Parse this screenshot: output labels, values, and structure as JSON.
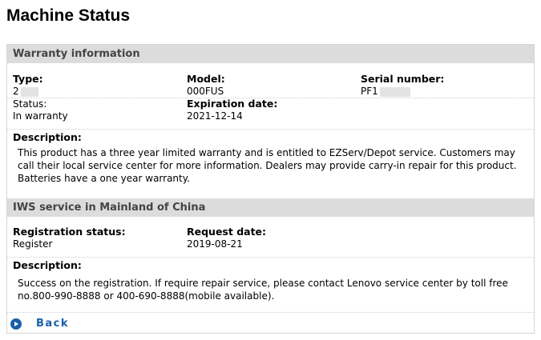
{
  "page": {
    "title": "Machine Status"
  },
  "warranty": {
    "header": "Warranty information",
    "type_label": "Type:",
    "type_value": "2",
    "model_label": "Model:",
    "model_value": "000FUS",
    "serial_label": "Serial number:",
    "serial_value": "PF1",
    "status_label": "Status:",
    "status_value": "In warranty",
    "expiration_label": "Expiration date:",
    "expiration_value": "2021-12-14",
    "description_label": "Description:",
    "description_text": "This product has a three year limited warranty and is entitled to EZServ/Depot service. Customers may call their local service center for more information. Dealers may provide carry-in repair for this product. Batteries have a one year warranty."
  },
  "iws": {
    "header": "IWS service in Mainland of China",
    "registration_label": "Registration status:",
    "registration_value": "Register",
    "request_label": "Request date:",
    "request_value": "2019-08-21",
    "description_label": "Description:",
    "description_text": "Success on the registration. If require repair service, please contact Lenovo service center by toll free no.800-990-8888 or 400-690-8888(mobile available)."
  },
  "nav": {
    "back_label": "Back",
    "back_icon": "circle-arrow-right-icon"
  },
  "colors": {
    "header_bg": "#dcdcdc",
    "link": "#1a5fa8"
  }
}
